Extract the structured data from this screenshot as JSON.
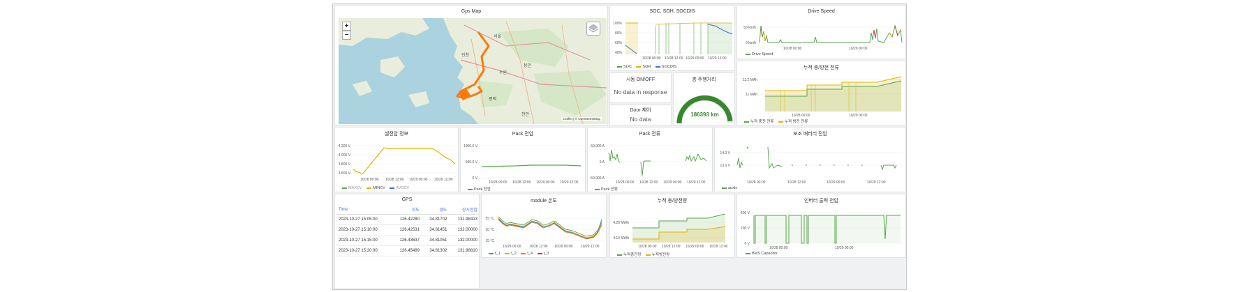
{
  "map": {
    "title": "Gps Map",
    "zoom_in": "+",
    "zoom_out": "−",
    "attribution": "Leaflet | © OpenStreetMap",
    "labels": [
      "서울",
      "인천",
      "용인",
      "수원",
      "평택",
      "천안"
    ]
  },
  "soc": {
    "title": "SOC, SOH, SOCDIS",
    "yticks": [
      "100%",
      "80%",
      "60%",
      "40%"
    ],
    "xticks": [
      "10/28 00:00",
      "10/28 12:00",
      "10/29 00:00",
      "10/29 12:00"
    ],
    "legend": [
      "SOC",
      "SOH",
      "SOCDIS"
    ]
  },
  "drive_speed": {
    "title": "Drive Speed",
    "yticks": [
      "50 km/h",
      "0 km/h"
    ],
    "xticks": [
      "10/28 00:00",
      "10/29 00:00"
    ],
    "legend": [
      "Drive Speed"
    ]
  },
  "startup": {
    "title": "시동 ON/OFF",
    "message": "No data in response"
  },
  "total_distance": {
    "title": "총 주행거리",
    "value": "186393 km",
    "gauge_fraction": 0.97
  },
  "door": {
    "title": "Door 제어",
    "message": "No data"
  },
  "cumulative_current": {
    "title": "누적 충/방전 전류",
    "yticks": [
      "11.2 MAh",
      "11 MAh"
    ],
    "xticks": [
      "10/28 00:00",
      "10/29 00:00"
    ],
    "legend": [
      "누적 충전 전류",
      "누적 방전 전류"
    ]
  },
  "cell_voltage": {
    "title": "셀전압 정보",
    "yticks": [
      "4.200 V",
      "4.000 V",
      "3.800 V",
      "3.600 V"
    ],
    "xticks": [
      "10/28 00:00",
      "10/28 12:00",
      "10/29 00:00",
      "10/29 12:00"
    ],
    "legend": [
      "MAXCV",
      "MINCV",
      "AVGCV"
    ]
  },
  "pack_voltage": {
    "title": "Pack 전압",
    "yticks": [
      "1000.0 V",
      "500.0 V",
      "0 V"
    ],
    "xticks": [
      "10/28 00:00",
      "10/28 12:00",
      "10/29 00:00",
      "10/29 12:00"
    ],
    "legend": [
      "Pack 전압"
    ]
  },
  "pack_current": {
    "title": "Pack 전류",
    "yticks": [
      "50.000 A",
      "0 A",
      "-50.000 A"
    ],
    "xticks": [
      "10/28 00:00",
      "10/28 12:00",
      "10/29 00:00",
      "10/29 12:00"
    ],
    "legend": [
      "Pack 전류"
    ]
  },
  "aux_battery": {
    "title": "보조 배터리 전압",
    "yticks": [
      "14.0 V",
      "13.0 V"
    ],
    "xticks": [
      "10/28 00:00",
      "10/28 12:00",
      "10/29 00:00",
      "10/29 12:00"
    ],
    "legend": [
      "auxIn"
    ]
  },
  "gps": {
    "title": "GPS",
    "columns": [
      "Time",
      "위도",
      "경도",
      "상시전압"
    ],
    "rows": [
      [
        "2023-10-27 15:05:00",
        "126.42280",
        "34.81702",
        "131.98413"
      ],
      [
        "2023-10-27 15:10:00",
        "126.42531",
        "34.81451",
        "132.00000"
      ],
      [
        "2023-10-27 15:15:00",
        "126.43637",
        "34.81051",
        "132.00000"
      ],
      [
        "2023-10-27 15:20:00",
        "126.45489",
        "34.81302",
        "131.98810"
      ]
    ]
  },
  "module_temp": {
    "title": "module 온도",
    "yticks": [
      "25 °C",
      "20 °C",
      "15 °C"
    ],
    "xticks": [
      "10/28 00:00",
      "10/28 12:00",
      "10/29 00:00",
      "10/29 12:00"
    ],
    "legend": [
      "t_1",
      "t_2",
      "t_4",
      "t_3"
    ]
  },
  "cumulative_power": {
    "title": "누적 충/방전량",
    "yticks": [
      "4.20 MWh",
      "4.10 MWh"
    ],
    "xticks": [
      "10/28 00:00",
      "10/28 12:00",
      "10/29 00:00",
      "10/29 12:00"
    ],
    "legend": [
      "누적충전량",
      "누적방전량"
    ]
  },
  "inverter": {
    "title": "인버터 출력 전압",
    "yticks": [
      "400 V",
      "200 V",
      "0 V"
    ],
    "xticks": [
      "10/28 00:00",
      "10/29 00:00"
    ],
    "legend": [
      "BMS Capacitor"
    ]
  },
  "colors": {
    "green": "#56a64b",
    "yellow": "#e0b400",
    "blue": "#3274d9",
    "orange": "#ff780a",
    "red": "#e02f44",
    "gauge": "#37872d"
  }
}
